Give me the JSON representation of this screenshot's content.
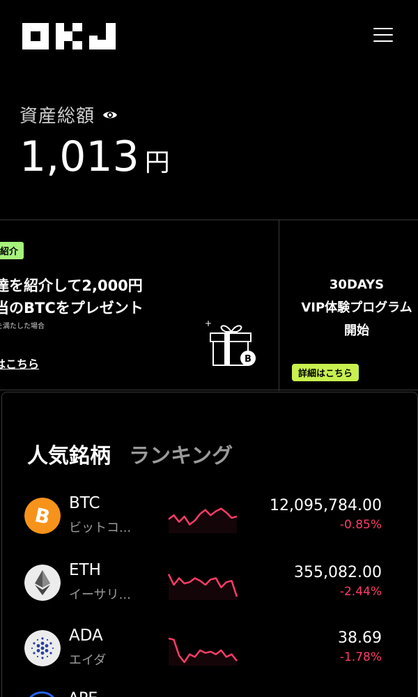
{
  "header": {
    "logo": "OKJ",
    "menu_icon": "hamburger-menu-icon"
  },
  "assets": {
    "label": "資産総額",
    "value": "1,013",
    "unit": "円",
    "eye_icon": "eye-icon"
  },
  "banners": {
    "referral": {
      "tag": "紹介",
      "line1": "達を紹介して2,000円",
      "line2": "当のBTCをプレゼント",
      "note": "を満たした場合",
      "link": "はこちら"
    },
    "vip": {
      "line1": "30DAYS",
      "line2": "VIP体験プログラム",
      "line3": "開始",
      "button": "詳細はこちら"
    }
  },
  "ranking": {
    "title": "人気銘柄",
    "subtitle": "ランキング",
    "down_color": "#ff3d67",
    "items": [
      {
        "symbol": "BTC",
        "name": "ビットコ...",
        "price": "12,095,784.00",
        "change": "-0.85%",
        "icon": "bitcoin-icon",
        "color": "#f7931a",
        "spark": [
          0.45,
          0.6,
          0.35,
          0.55,
          0.25,
          0.4,
          0.65,
          0.8,
          0.6,
          0.75,
          0.85,
          0.7,
          0.5,
          0.55
        ]
      },
      {
        "symbol": "ETH",
        "name": "イーサリ...",
        "price": "355,082.00",
        "change": "-2.44%",
        "icon": "ethereum-icon",
        "color": "#ececec",
        "spark": [
          0.9,
          0.5,
          0.75,
          0.55,
          0.6,
          0.75,
          0.65,
          0.5,
          0.7,
          0.75,
          0.4,
          0.6,
          0.65,
          0.05
        ]
      },
      {
        "symbol": "ADA",
        "name": "エイダ",
        "price": "38.69",
        "change": "-1.78%",
        "icon": "cardano-icon",
        "color": "#ececec",
        "spark": [
          0.95,
          0.9,
          0.3,
          0.05,
          0.35,
          0.25,
          0.5,
          0.4,
          0.45,
          0.35,
          0.5,
          0.25,
          0.35,
          0.1
        ]
      }
    ],
    "partial_symbol": "APE"
  }
}
